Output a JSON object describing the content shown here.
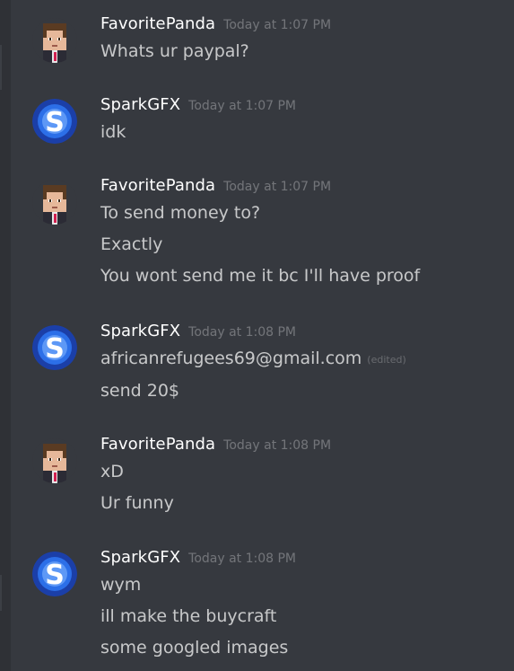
{
  "users": {
    "panda": {
      "name": "FavoritePanda",
      "avatar_icon": "minecraft-character-avatar"
    },
    "spark": {
      "name": "SparkGFX",
      "avatar_icon": "blue-s-logo-avatar",
      "avatar_color": "#1e5bd8"
    }
  },
  "colors": {
    "background": "#36393f",
    "username": "#ffffff",
    "message_text": "#b9bbbe",
    "timestamp": "#72767d"
  },
  "messages": [
    {
      "author": "FavoritePanda",
      "timestamp": "Today at 1:07 PM",
      "lines": [
        "Whats ur paypal?"
      ]
    },
    {
      "author": "SparkGFX",
      "timestamp": "Today at 1:07 PM",
      "lines": [
        "idk"
      ]
    },
    {
      "author": "FavoritePanda",
      "timestamp": "Today at 1:07 PM",
      "lines": [
        "To send money to?",
        "Exactly",
        "You wont send me it bc I'll have proof"
      ]
    },
    {
      "author": "SparkGFX",
      "timestamp": "Today at 1:08 PM",
      "lines": [
        "africanrefugees69@gmail.com",
        "send 20$"
      ],
      "edited_label": "(edited)"
    },
    {
      "author": "FavoritePanda",
      "timestamp": "Today at 1:08 PM",
      "lines": [
        "xD",
        "Ur funny"
      ]
    },
    {
      "author": "SparkGFX",
      "timestamp": "Today at 1:08 PM",
      "lines": [
        "wym",
        "ill make the buycraft",
        "some googled images"
      ]
    }
  ]
}
